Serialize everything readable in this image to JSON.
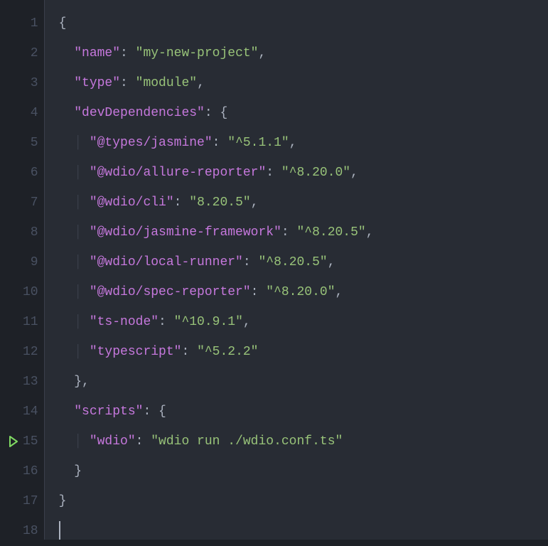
{
  "lineNumbers": [
    "1",
    "2",
    "3",
    "4",
    "5",
    "6",
    "7",
    "8",
    "9",
    "10",
    "11",
    "12",
    "13",
    "14",
    "15",
    "16",
    "17",
    "18"
  ],
  "runIconLine": 15,
  "json": {
    "name_key": "\"name\"",
    "name_val": "\"my-new-project\"",
    "type_key": "\"type\"",
    "type_val": "\"module\"",
    "devDeps_key": "\"devDependencies\"",
    "deps": {
      "types_jasmine_key": "\"@types/jasmine\"",
      "types_jasmine_val": "\"^5.1.1\"",
      "allure_key": "\"@wdio/allure-reporter\"",
      "allure_val": "\"^8.20.0\"",
      "cli_key": "\"@wdio/cli\"",
      "cli_val": "\"8.20.5\"",
      "jasmine_fw_key": "\"@wdio/jasmine-framework\"",
      "jasmine_fw_val": "\"^8.20.5\"",
      "local_runner_key": "\"@wdio/local-runner\"",
      "local_runner_val": "\"^8.20.5\"",
      "spec_rep_key": "\"@wdio/spec-reporter\"",
      "spec_rep_val": "\"^8.20.0\"",
      "tsnode_key": "\"ts-node\"",
      "tsnode_val": "\"^10.9.1\"",
      "typescript_key": "\"typescript\"",
      "typescript_val": "\"^5.2.2\""
    },
    "scripts_key": "\"scripts\"",
    "scripts": {
      "wdio_key": "\"wdio\"",
      "wdio_val": "\"wdio run ./wdio.conf.ts\""
    }
  },
  "punct": {
    "open_brace": "{",
    "close_brace": "}",
    "colon_space": ": ",
    "comma": ",",
    "close_brace_comma": "},"
  }
}
